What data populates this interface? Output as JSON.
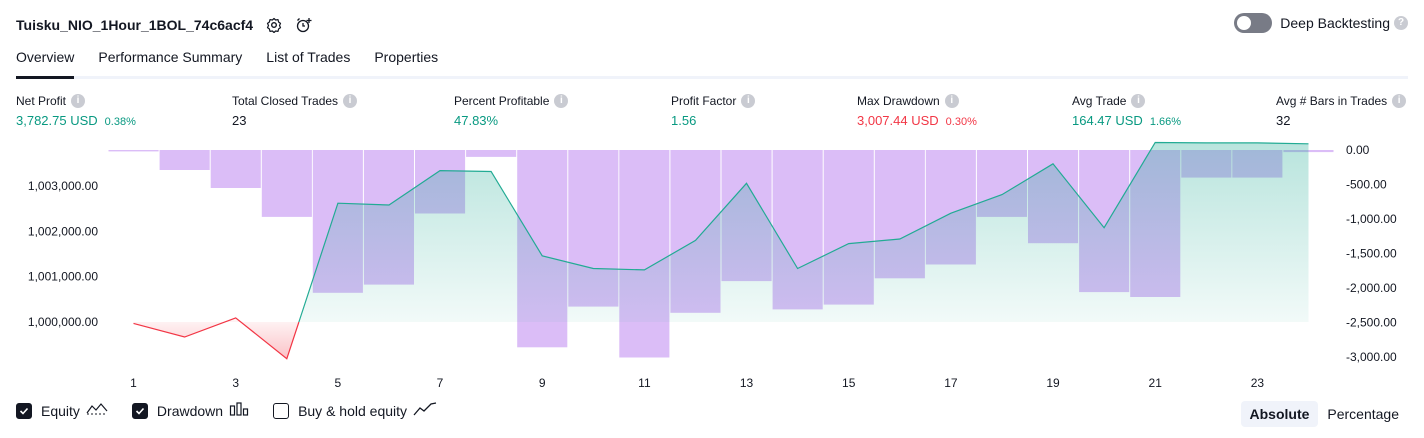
{
  "header": {
    "title": "Tuisku_NIO_1Hour_1BOL_74c6acf4"
  },
  "deep_backtesting": {
    "label": "Deep Backtesting",
    "enabled": false
  },
  "tabs": [
    {
      "label": "Overview",
      "active": true
    },
    {
      "label": "Performance Summary",
      "active": false
    },
    {
      "label": "List of Trades",
      "active": false
    },
    {
      "label": "Properties",
      "active": false
    }
  ],
  "metrics": [
    {
      "label": "Net Profit",
      "value": "3,782.75 USD",
      "pct": "0.38%",
      "tone": "pos"
    },
    {
      "label": "Total Closed Trades",
      "value": "23",
      "pct": "",
      "tone": "neutral"
    },
    {
      "label": "Percent Profitable",
      "value": "47.83%",
      "pct": "",
      "tone": "pos"
    },
    {
      "label": "Profit Factor",
      "value": "1.56",
      "pct": "",
      "tone": "pos"
    },
    {
      "label": "Max Drawdown",
      "value": "3,007.44 USD",
      "pct": "0.30%",
      "tone": "neg"
    },
    {
      "label": "Avg Trade",
      "value": "164.47 USD",
      "pct": "1.66%",
      "tone": "pos"
    },
    {
      "label": "Avg # Bars in Trades",
      "value": "32",
      "pct": "",
      "tone": "neutral"
    }
  ],
  "chart_data": {
    "type": "line",
    "x": [
      1,
      2,
      3,
      4,
      5,
      6,
      7,
      8,
      9,
      10,
      11,
      12,
      13,
      14,
      15,
      16,
      17,
      18,
      19,
      20,
      21,
      22,
      23,
      24
    ],
    "x_ticks": [
      "1",
      "3",
      "5",
      "7",
      "9",
      "11",
      "13",
      "15",
      "17",
      "19",
      "21",
      "23"
    ],
    "series": [
      {
        "name": "Equity",
        "axis": "left",
        "style": "line-area",
        "values": [
          999970,
          999670,
          1000090,
          999190,
          1002620,
          1002580,
          1003340,
          1003320,
          1001460,
          1001180,
          1001150,
          1001800,
          1003060,
          1001180,
          1001730,
          1001830,
          1002400,
          1002810,
          1003490,
          1002080,
          1003960,
          1003950,
          1003950,
          1003930
        ]
      },
      {
        "name": "Drawdown",
        "axis": "right",
        "style": "bar",
        "values": [
          -20,
          -290,
          -550,
          -970,
          -2070,
          -1950,
          -920,
          -100,
          -2860,
          -2270,
          -3007,
          -2360,
          -1900,
          -2310,
          -2240,
          -1860,
          -1660,
          -970,
          -1350,
          -2060,
          -2130,
          -400,
          -400,
          -30
        ]
      }
    ],
    "y_left_ticks": [
      "1,000,000.00",
      "1,001,000.00",
      "1,002,000.00",
      "1,003,000.00"
    ],
    "y_right_ticks": [
      "0.00",
      "-500.00",
      "-1,000.00",
      "-1,500.00",
      "-2,000.00",
      "-2,500.00",
      "-3,000.00"
    ],
    "colors": {
      "equity_up": "#22ab94",
      "equity_down": "#f23645",
      "drawdown": "#d1aaf5"
    }
  },
  "legend": [
    {
      "label": "Equity",
      "checked": true,
      "icon": "equity-line-icon"
    },
    {
      "label": "Drawdown",
      "checked": true,
      "icon": "bars-icon"
    },
    {
      "label": "Buy & hold equity",
      "checked": false,
      "icon": "line-chart-icon"
    }
  ],
  "modes": [
    {
      "label": "Absolute",
      "active": true
    },
    {
      "label": "Percentage",
      "active": false
    }
  ]
}
